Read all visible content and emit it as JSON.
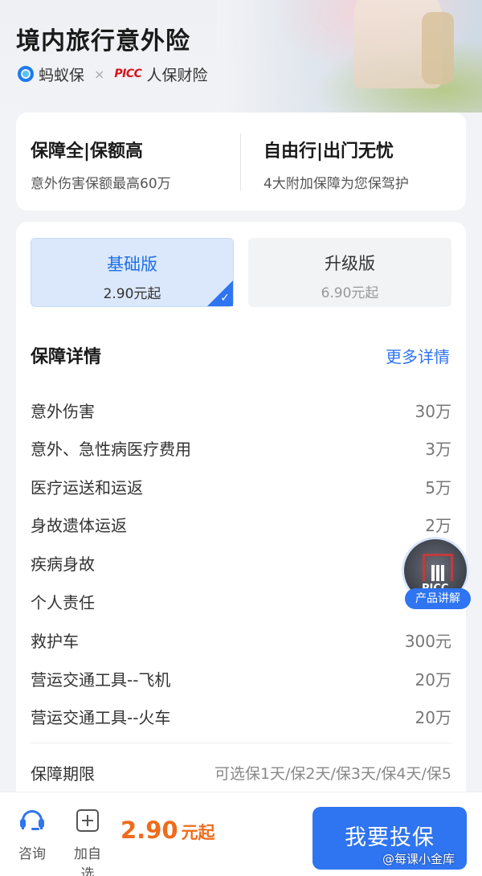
{
  "header": {
    "title": "境内旅行意外险",
    "brand_left": "蚂蚁保",
    "separator": "×",
    "brand_right_logo": "PICC",
    "brand_right": "人保财险"
  },
  "features": [
    {
      "title": "保障全|保额高",
      "subtitle": "意外伤害保额最高60万"
    },
    {
      "title": "自由行|出门无忧",
      "subtitle": "4大附加保障为您保驾护"
    }
  ],
  "plans": [
    {
      "name": "基础版",
      "price": "2.90元起",
      "selected": true
    },
    {
      "name": "升级版",
      "price": "6.90元起",
      "selected": false
    }
  ],
  "coverage": {
    "heading": "保障详情",
    "more_link": "更多详情",
    "items": [
      {
        "label": "意外伤害",
        "value": "30万"
      },
      {
        "label": "意外、急性病医疗费用",
        "value": "3万"
      },
      {
        "label": "医疗运送和运返",
        "value": "5万"
      },
      {
        "label": "身故遗体运返",
        "value": "2万"
      },
      {
        "label": "疾病身故",
        "value": ""
      },
      {
        "label": "个人责任",
        "value": ""
      },
      {
        "label": "救护车",
        "value": "300元"
      },
      {
        "label": "营运交通工具--飞机",
        "value": "20万"
      },
      {
        "label": "营运交通工具--火车",
        "value": "20万"
      }
    ],
    "period_label": "保障期限",
    "period_value": "可选保1天/保2天/保3天/保4天/保5"
  },
  "float_badge": {
    "logo_text": "PICC",
    "label": "产品讲解"
  },
  "bottom_bar": {
    "consult_label": "咨询",
    "add_label": "加自选",
    "price_num": "2.90",
    "price_unit": "元起",
    "buy_label": "我要投保"
  },
  "watermark": "@每课小金库",
  "colors": {
    "accent": "#2f74f0",
    "price": "#ef6b1b",
    "picc_red": "#d8121b"
  }
}
